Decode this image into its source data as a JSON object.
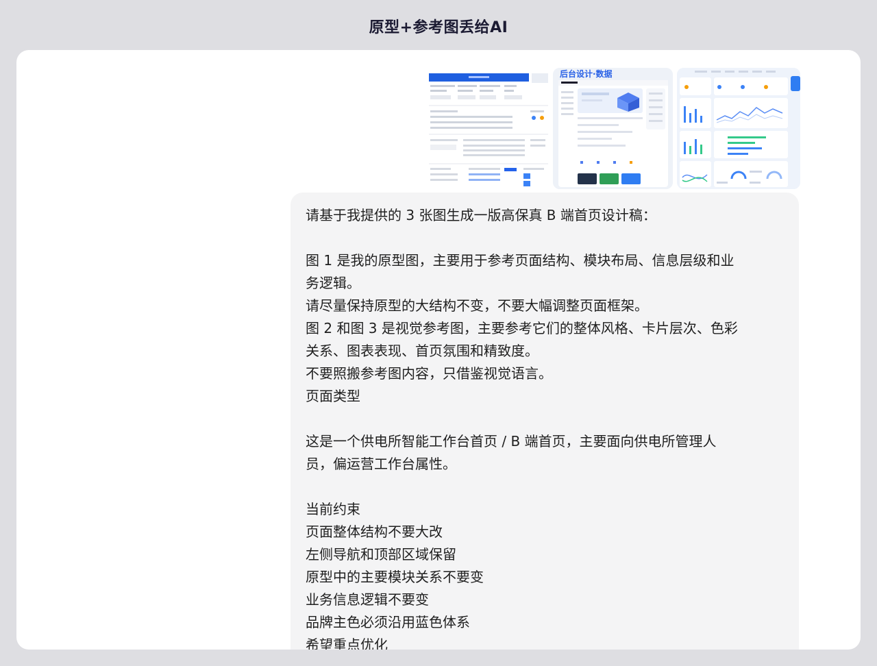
{
  "frame": {
    "title": "原型+参考图丢给AI"
  },
  "attachments": {
    "images": [
      {
        "icon": "prototype-image-thumbnail"
      },
      {
        "icon": "reference-image-thumbnail",
        "label": "后台设计·数据"
      },
      {
        "icon": "reference-dashboard-thumbnail"
      }
    ]
  },
  "message": {
    "lines": [
      "请基于我提供的 3 张图生成一版高保真 B 端首页设计稿：",
      "",
      "图 1 是我的原型图，主要用于参考页面结构、模块布局、信息层级和业",
      "务逻辑。",
      "请尽量保持原型的大结构不变，不要大幅调整页面框架。",
      "图 2 和图 3 是视觉参考图，主要参考它们的整体风格、卡片层次、色彩",
      "关系、图表表现、首页氛围和精致度。",
      "不要照搬参考图内容，只借鉴视觉语言。",
      "页面类型",
      "",
      "这是一个供电所智能工作台首页 / B 端首页，主要面向供电所管理人",
      "员，偏运营工作台属性。",
      "",
      "当前约束",
      "页面整体结构不要大改",
      "左侧导航和顶部区域保留",
      "原型中的主要模块关系不要变",
      "业务信息逻辑不要变",
      "品牌主色必须沿用蓝色体系",
      "希望重点优化"
    ]
  },
  "colors": {
    "frame_bg": "#dedee2",
    "panel_bg": "#ffffff",
    "bubble_bg": "#f4f4f5",
    "accent_blue": "#2a62e6"
  }
}
